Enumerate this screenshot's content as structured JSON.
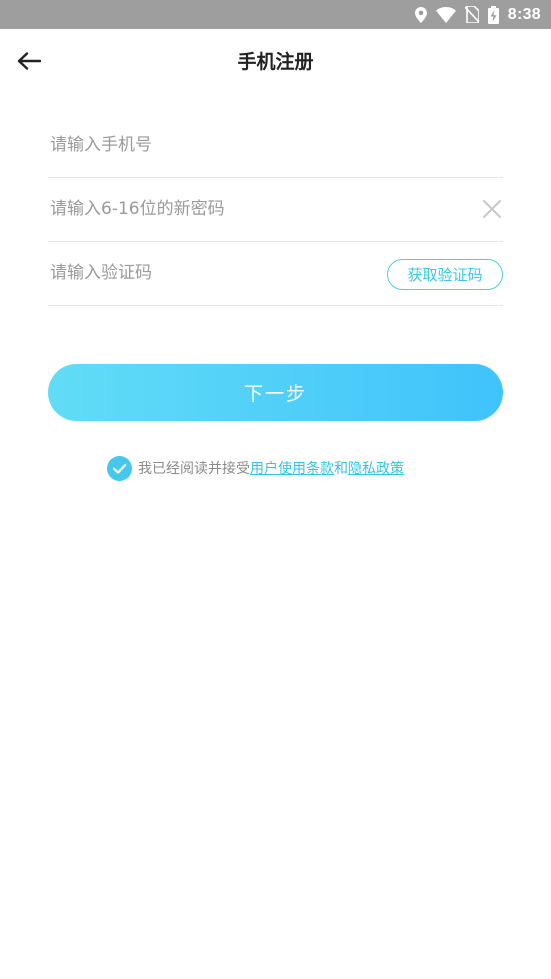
{
  "status_bar": {
    "time": "8:38",
    "icons": [
      "location-icon",
      "wifi-icon",
      "no-sim-icon",
      "battery-charging-icon"
    ]
  },
  "header": {
    "back_icon": "arrow-left-icon",
    "title": "手机注册"
  },
  "form": {
    "phone": {
      "placeholder": "请输入手机号",
      "value": ""
    },
    "password": {
      "placeholder": "请输入6-16位的新密码",
      "value": "",
      "clear_icon": "close-icon"
    },
    "code": {
      "placeholder": "请输入验证码",
      "value": "",
      "button_label": "获取验证码"
    },
    "next_label": "下一步"
  },
  "agreement": {
    "checked": true,
    "prefix": "我已经阅读并接受",
    "terms_label": "用户使用条款",
    "and": "和",
    "privacy_label": "隐私政策"
  },
  "colors": {
    "accent": "#3cc8e3",
    "button_start": "#62dcf6",
    "button_end": "#3fc3fb",
    "status_bar": "#9e9e9e"
  }
}
